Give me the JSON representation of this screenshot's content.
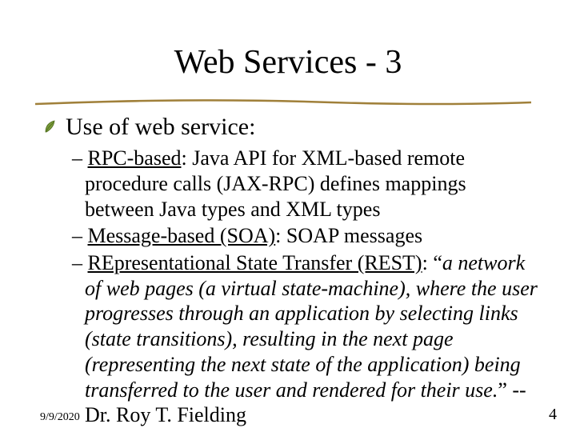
{
  "title": "Web Services - 3",
  "lvl1": "Use of web service:",
  "bullets": {
    "b1": {
      "p1": "RPC-based",
      "p2": ": Java API for XML-based remote procedure calls (JAX-RPC) defines mappings between Java types and XML types"
    },
    "b2": {
      "p1": "Message-based (SOA)",
      "p2": ": SOAP messages"
    },
    "b3": {
      "p1": "REpresentational State Transfer (REST)",
      "p2": ": “",
      "p3": "a network of web pages (a virtual state-machine), where the user progresses through an application by selecting links (state transitions), resulting in the next page (representing the next state of the application) being transferred to the user and rendered for their use.",
      "p4": "” -- Dr. Roy T. Fielding"
    }
  },
  "footer": {
    "date": "9/9/2020",
    "page": "4"
  },
  "dash": "– "
}
